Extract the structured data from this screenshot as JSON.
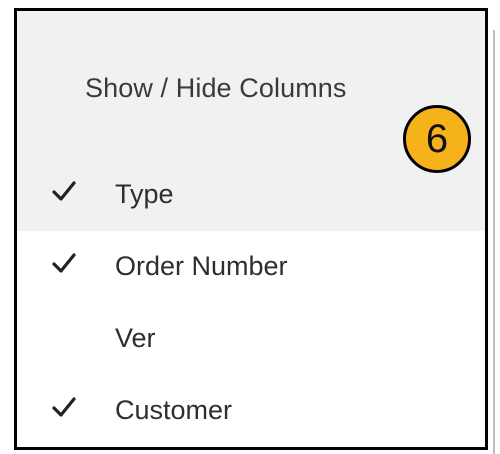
{
  "menu": {
    "title": "Show / Hide Columns",
    "items": [
      {
        "label": "Type",
        "checked": true,
        "highlighted": true
      },
      {
        "label": "Order Number",
        "checked": true,
        "highlighted": false
      },
      {
        "label": "Ver",
        "checked": false,
        "highlighted": false
      },
      {
        "label": "Customer",
        "checked": true,
        "highlighted": false
      }
    ]
  },
  "callout": {
    "number": "6",
    "color": "#f5b21a"
  },
  "colors": {
    "highlight": "#f1f1f1",
    "border": "#000000"
  },
  "icons": {
    "check": "check-icon"
  }
}
